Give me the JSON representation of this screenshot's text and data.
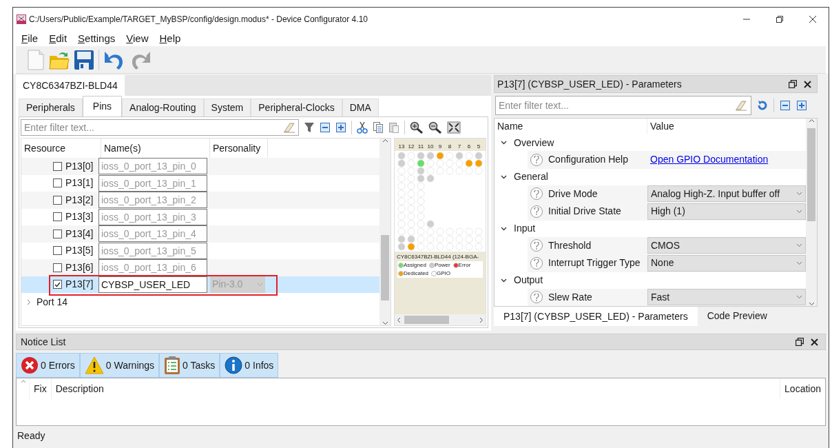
{
  "window": {
    "title": "C:/Users/Public/Example/TARGET_MyBSP/config/design.modus* - Device Configurator 4.10"
  },
  "menu": [
    "File",
    "Edit",
    "Settings",
    "View",
    "Help"
  ],
  "device_tab": {
    "label": "CY8C6347BZI-BLD44",
    "selected": true
  },
  "tabs": [
    {
      "label": "Peripherals",
      "selected": false
    },
    {
      "label": "Pins",
      "selected": true
    },
    {
      "label": "Analog-Routing",
      "selected": false
    },
    {
      "label": "System",
      "selected": false
    },
    {
      "label": "Peripheral-Clocks",
      "selected": false
    },
    {
      "label": "DMA",
      "selected": false
    }
  ],
  "pins": {
    "filter": {
      "placeholder": "Enter filter text..."
    },
    "columns": [
      "Resource",
      "Name(s)",
      "Personality"
    ],
    "rows": [
      {
        "resource": "P13[0]",
        "name": {
          "placeholder": "ioss_0_port_13_pin_0"
        },
        "checked": false,
        "selected": false,
        "highlighted": false
      },
      {
        "resource": "P13[1]",
        "name": {
          "placeholder": "ioss_0_port_13_pin_1"
        },
        "checked": false,
        "selected": false,
        "highlighted": false
      },
      {
        "resource": "P13[2]",
        "name": {
          "placeholder": "ioss_0_port_13_pin_2"
        },
        "checked": false,
        "selected": false,
        "highlighted": false
      },
      {
        "resource": "P13[3]",
        "name": {
          "placeholder": "ioss_0_port_13_pin_3"
        },
        "checked": false,
        "selected": false,
        "highlighted": false
      },
      {
        "resource": "P13[4]",
        "name": {
          "placeholder": "ioss_0_port_13_pin_4"
        },
        "checked": false,
        "selected": false,
        "highlighted": false
      },
      {
        "resource": "P13[5]",
        "name": {
          "placeholder": "ioss_0_port_13_pin_5"
        },
        "checked": false,
        "selected": false,
        "highlighted": false
      },
      {
        "resource": "P13[6]",
        "name": {
          "placeholder": "ioss_0_port_13_pin_6"
        },
        "checked": false,
        "selected": false,
        "highlighted": false
      },
      {
        "resource": "P13[7]",
        "name": {
          "value": "CYBSP_USER_LED"
        },
        "personality": "Pin-3.0",
        "checked": true,
        "selected": true,
        "highlighted": true
      }
    ],
    "nodes": [
      {
        "label": "Port 14",
        "expanded": false
      }
    ]
  },
  "pin_map": {
    "column_labels": [
      "13",
      "12",
      "11",
      "10",
      "9",
      "8",
      "7",
      "6",
      "5"
    ],
    "caption": "CY8C6347BZI-BLD44 (124-BGA-",
    "legend": [
      {
        "label": "Assigned",
        "color": "#66dd66"
      },
      {
        "label": "Power",
        "color": "#cccccc"
      },
      {
        "label": "Error",
        "color": "#ee3333"
      },
      {
        "label": "Dedicated",
        "color": "#f5a000"
      },
      {
        "label": "GPIO",
        "color": "#ffffff"
      }
    ]
  },
  "parameters": {
    "title": "P13[7] (CYBSP_USER_LED) - Parameters",
    "filter": {
      "placeholder": "Enter filter text..."
    },
    "columns": [
      "Name",
      "Value"
    ],
    "groups": [
      {
        "label": "Overview",
        "expanded": true,
        "children": [
          {
            "label": "Configuration Help",
            "kind": "link",
            "value": "Open GPIO Documentation"
          }
        ]
      },
      {
        "label": "General",
        "expanded": true,
        "children": [
          {
            "label": "Drive Mode",
            "kind": "dropdown",
            "value": "Analog High-Z. Input buffer off"
          },
          {
            "label": "Initial Drive State",
            "kind": "dropdown",
            "value": "High (1)"
          }
        ]
      },
      {
        "label": "Input",
        "expanded": true,
        "children": [
          {
            "label": "Threshold",
            "kind": "dropdown",
            "value": "CMOS"
          },
          {
            "label": "Interrupt Trigger Type",
            "kind": "dropdown",
            "value": "None"
          }
        ]
      },
      {
        "label": "Output",
        "expanded": true,
        "children": [
          {
            "label": "Slew Rate",
            "kind": "dropdown",
            "value": "Fast"
          }
        ]
      }
    ],
    "tabs": [
      {
        "label": "P13[7] (CYBSP_USER_LED) - Parameters",
        "selected": true
      },
      {
        "label": "Code Preview",
        "selected": false
      }
    ]
  },
  "notice_list": {
    "title": "Notice List",
    "counters": [
      {
        "kind": "error",
        "label": "0 Errors"
      },
      {
        "kind": "warning",
        "label": "0 Warnings"
      },
      {
        "kind": "task",
        "label": "0 Tasks"
      },
      {
        "kind": "info",
        "label": "0 Infos"
      }
    ],
    "columns": [
      "Fix",
      "Description",
      "Location"
    ]
  },
  "status_bar": "Ready"
}
